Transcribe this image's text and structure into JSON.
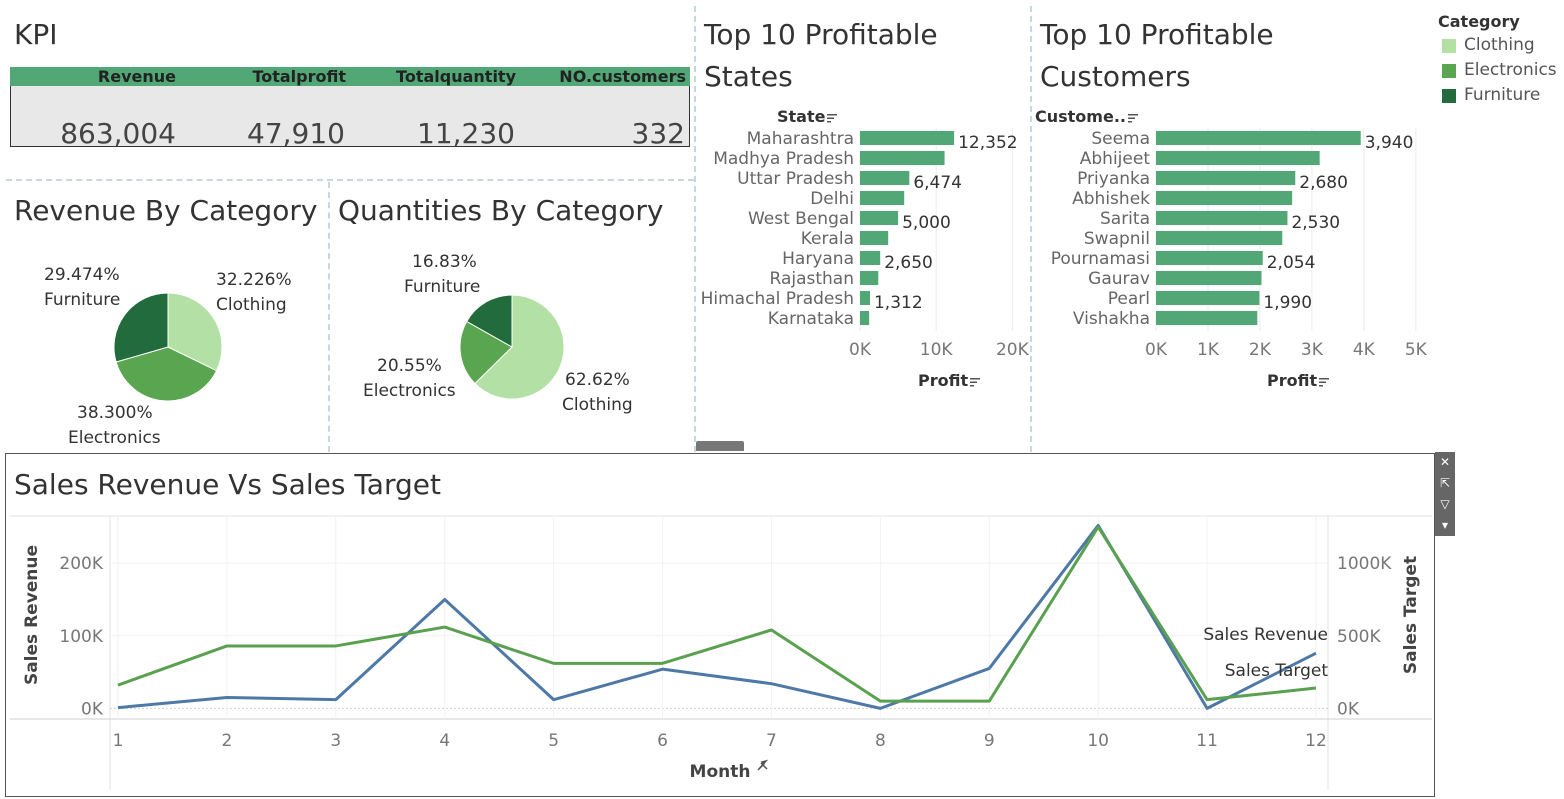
{
  "kpi": {
    "title": "KPI",
    "headers": [
      "Revenue",
      "Totalprofit",
      "Totalquantity",
      "NO.customers"
    ],
    "values": [
      "863,004",
      "47,910",
      "11,230",
      "332"
    ]
  },
  "revenue_by_category": {
    "title": "Revenue  By Category",
    "slices": [
      {
        "label": "Clothing",
        "pct": "32.226%",
        "value": 32.226,
        "color": "#b3e0a5"
      },
      {
        "label": "Electronics",
        "pct": "38.300%",
        "value": 38.3,
        "color": "#5aa54f"
      },
      {
        "label": "Furniture",
        "pct": "29.474%",
        "value": 29.474,
        "color": "#216b3d"
      }
    ]
  },
  "quantities_by_category": {
    "title": "Quantities By Category",
    "slices": [
      {
        "label": "Clothing",
        "pct": "62.62%",
        "value": 62.62,
        "color": "#b3e0a5"
      },
      {
        "label": "Electronics",
        "pct": "20.55%",
        "value": 20.55,
        "color": "#5aa54f"
      },
      {
        "label": "Furniture",
        "pct": "16.83%",
        "value": 16.83,
        "color": "#216b3d"
      }
    ]
  },
  "top_states": {
    "title_line1": "Top 10 Profitable",
    "title_line2": "States",
    "dim_header": "State",
    "measure": "Profit",
    "ticks": [
      "0K",
      "10K",
      "20K"
    ],
    "tick_values": [
      0,
      10000,
      20000
    ],
    "xmax": 21000,
    "rows": [
      {
        "label": "Maharashtra",
        "value": 12352,
        "text": "12,352"
      },
      {
        "label": "Madhya Pradesh",
        "value": 11100,
        "text": ""
      },
      {
        "label": "Uttar Pradesh",
        "value": 6474,
        "text": "6,474"
      },
      {
        "label": "Delhi",
        "value": 5800,
        "text": ""
      },
      {
        "label": "West Bengal",
        "value": 5000,
        "text": "5,000"
      },
      {
        "label": "Kerala",
        "value": 3700,
        "text": ""
      },
      {
        "label": "Haryana",
        "value": 2650,
        "text": "2,650"
      },
      {
        "label": "Rajasthan",
        "value": 2400,
        "text": ""
      },
      {
        "label": "Himachal Pradesh",
        "value": 1312,
        "text": "1,312"
      },
      {
        "label": "Karnataka",
        "value": 1200,
        "text": ""
      }
    ]
  },
  "top_customers": {
    "title_line1": "Top 10 Profitable",
    "title_line2": "Customers",
    "dim_header": "Custome..",
    "measure": "Profit",
    "ticks": [
      "0K",
      "1K",
      "2K",
      "3K",
      "4K",
      "5K"
    ],
    "tick_values": [
      0,
      1000,
      2000,
      3000,
      4000,
      5000
    ],
    "xmax": 5100,
    "rows": [
      {
        "label": "Seema",
        "value": 3940,
        "text": "3,940"
      },
      {
        "label": "Abhijeet",
        "value": 3150,
        "text": ""
      },
      {
        "label": "Priyanka",
        "value": 2680,
        "text": "2,680"
      },
      {
        "label": "Abhishek",
        "value": 2620,
        "text": ""
      },
      {
        "label": "Sarita",
        "value": 2530,
        "text": "2,530"
      },
      {
        "label": "Swapnil",
        "value": 2430,
        "text": ""
      },
      {
        "label": "Pournamasi",
        "value": 2054,
        "text": "2,054"
      },
      {
        "label": "Gaurav",
        "value": 2030,
        "text": ""
      },
      {
        "label": "Pearl",
        "value": 1990,
        "text": "1,990"
      },
      {
        "label": "Vishakha",
        "value": 1950,
        "text": ""
      }
    ]
  },
  "legend": {
    "title": "Category",
    "items": [
      {
        "label": "Clothing",
        "color": "#b3e0a5"
      },
      {
        "label": "Electronics",
        "color": "#5aa54f"
      },
      {
        "label": "Furniture",
        "color": "#216b3d"
      }
    ]
  },
  "line_chart": {
    "title": "Sales Revenue Vs Sales Target",
    "xlabel": "Month",
    "ylabel_left": "Sales Revenue",
    "ylabel_right": "Sales Target",
    "left_ticks": [
      "0K",
      "100K",
      "200K"
    ],
    "left_tick_values": [
      0,
      100000,
      200000
    ],
    "right_ticks": [
      "0K",
      "500K",
      "1000K"
    ],
    "right_tick_values": [
      0,
      500000,
      1000000
    ],
    "series_labels": [
      "Sales Revenue",
      "Sales Target"
    ]
  },
  "chart_data": [
    {
      "type": "pie",
      "title": "Revenue  By Category",
      "categories": [
        "Clothing",
        "Electronics",
        "Furniture"
      ],
      "values": [
        32.226,
        38.3,
        29.474
      ]
    },
    {
      "type": "pie",
      "title": "Quantities By Category",
      "categories": [
        "Clothing",
        "Electronics",
        "Furniture"
      ],
      "values": [
        62.62,
        20.55,
        16.83
      ]
    },
    {
      "type": "bar",
      "title": "Top 10 Profitable States",
      "categories": [
        "Maharashtra",
        "Madhya Pradesh",
        "Uttar Pradesh",
        "Delhi",
        "West Bengal",
        "Kerala",
        "Haryana",
        "Rajasthan",
        "Himachal Pradesh",
        "Karnataka"
      ],
      "values": [
        12352,
        11100,
        6474,
        5800,
        5000,
        3700,
        2650,
        2400,
        1312,
        1200
      ],
      "xlabel": "Profit",
      "ylabel": "State",
      "xlim": [
        0,
        21000
      ]
    },
    {
      "type": "bar",
      "title": "Top 10 Profitable Customers",
      "categories": [
        "Seema",
        "Abhijeet",
        "Priyanka",
        "Abhishek",
        "Sarita",
        "Swapnil",
        "Pournamasi",
        "Gaurav",
        "Pearl",
        "Vishakha"
      ],
      "values": [
        3940,
        3150,
        2680,
        2620,
        2530,
        2430,
        2054,
        2030,
        1990,
        1950
      ],
      "xlabel": "Profit",
      "ylabel": "Custome..",
      "xlim": [
        0,
        5100
      ]
    },
    {
      "type": "line",
      "title": "Sales Revenue Vs Sales Target",
      "x": [
        1,
        2,
        3,
        4,
        5,
        6,
        7,
        8,
        9,
        10,
        11,
        12
      ],
      "series": [
        {
          "name": "Sales Revenue",
          "axis": "left",
          "color": "#4e79a7",
          "values": [
            1000,
            15000,
            12000,
            150000,
            12000,
            54000,
            34000,
            0,
            55000,
            252000,
            0,
            76000
          ]
        },
        {
          "name": "Sales Target",
          "axis": "right",
          "color": "#59a14f",
          "values": [
            160000,
            430000,
            430000,
            560000,
            310000,
            310000,
            540000,
            50000,
            50000,
            1250000,
            60000,
            140000
          ]
        }
      ],
      "xlabel": "Month",
      "ylabel": "Sales Revenue",
      "y2label": "Sales Target",
      "ylim": [
        -5000,
        265000
      ],
      "y2lim": [
        -25000,
        1325000
      ]
    }
  ]
}
